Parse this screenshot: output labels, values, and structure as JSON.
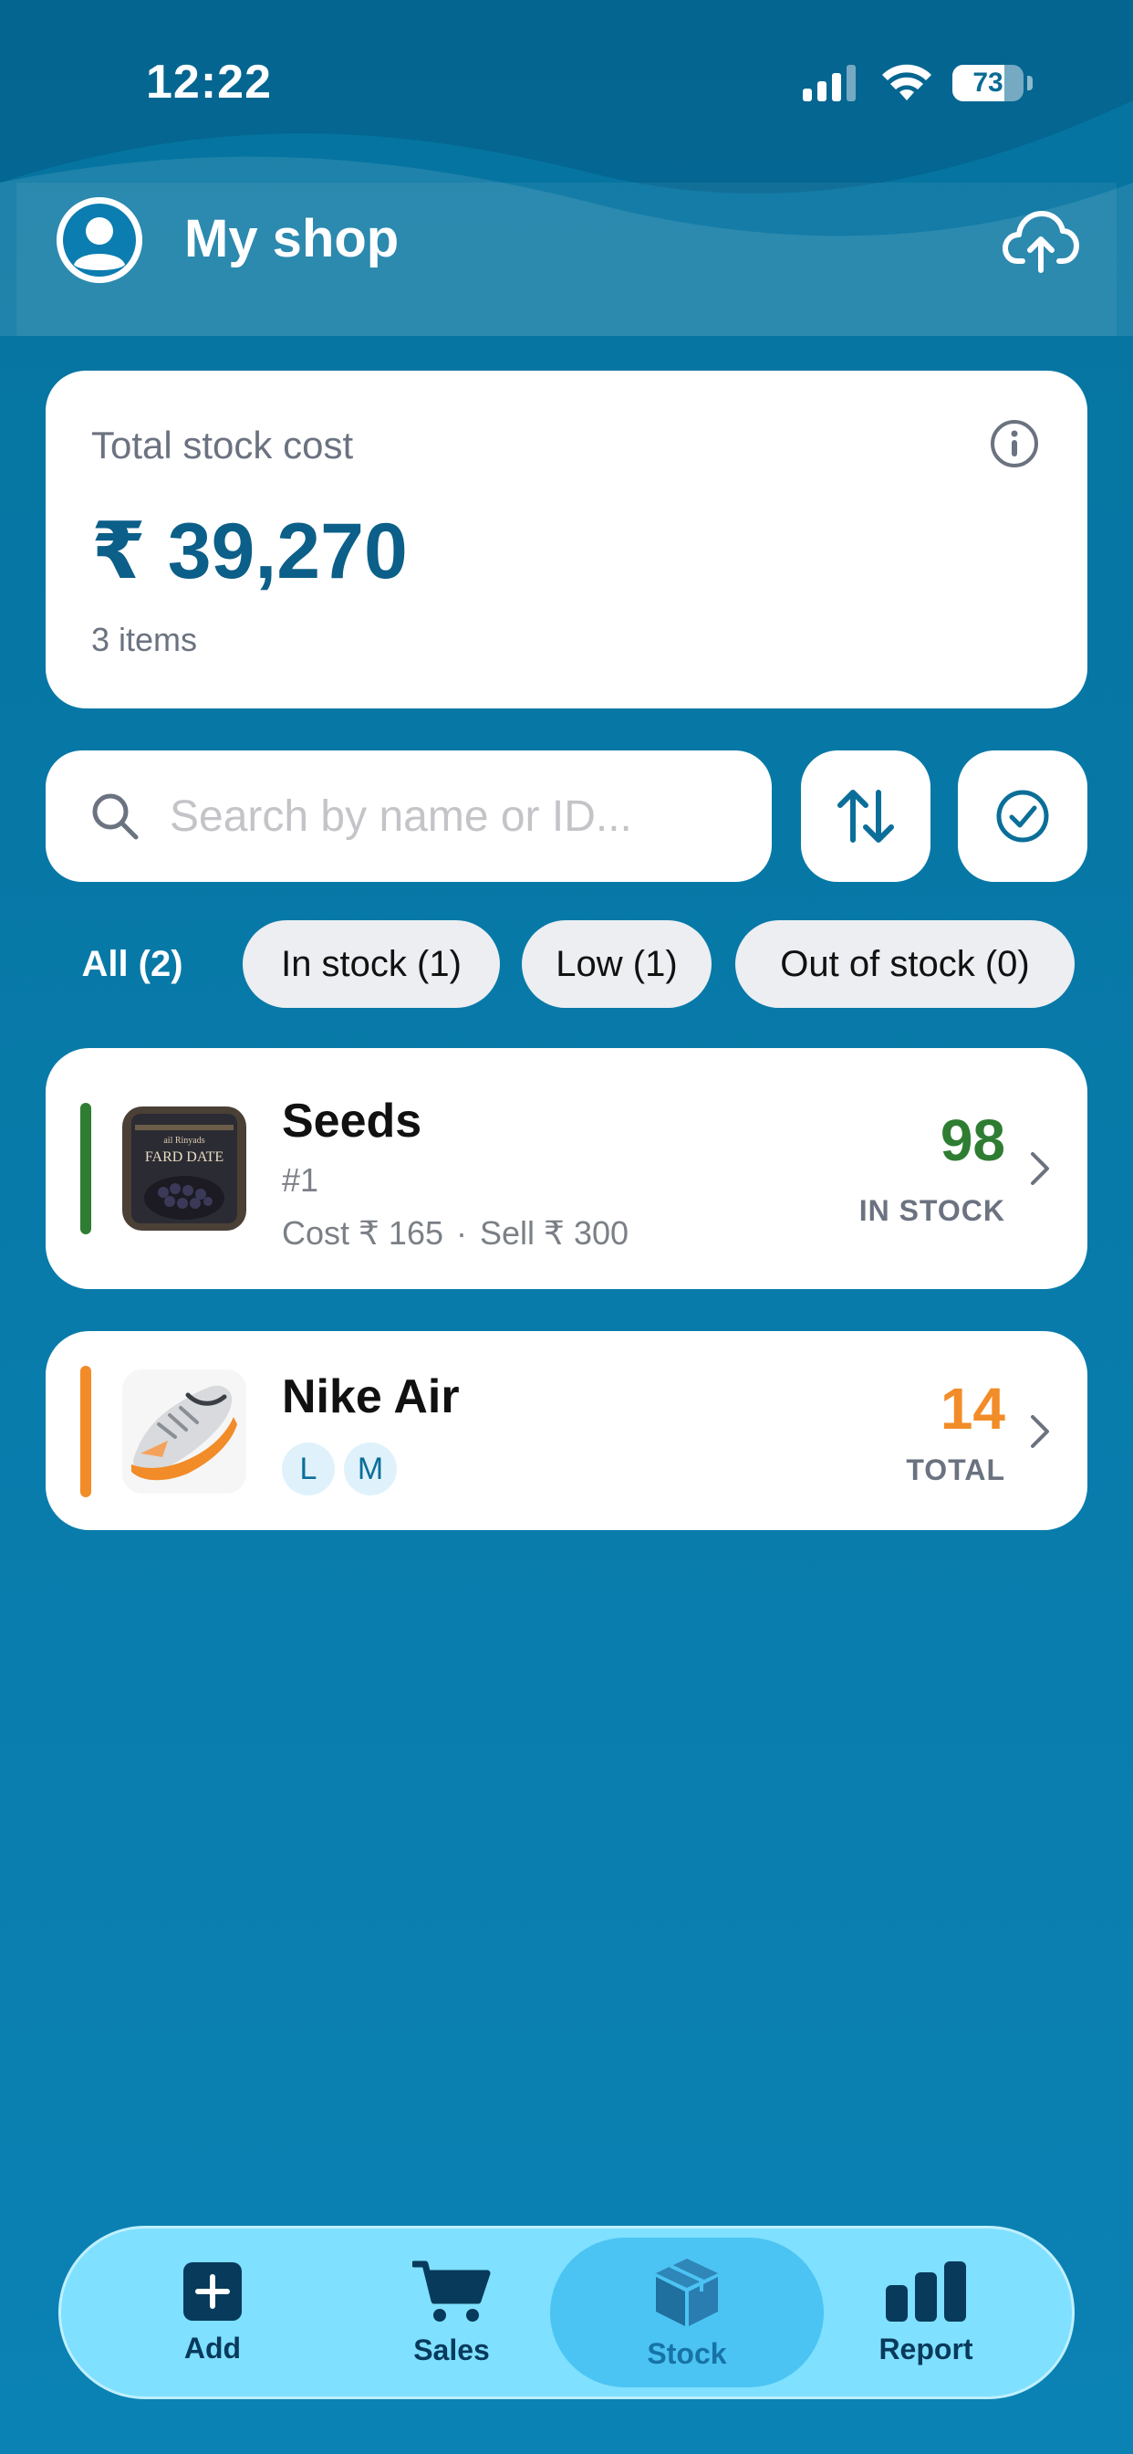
{
  "status_bar": {
    "time": "12:22",
    "battery": "73",
    "battery_level": 0.73
  },
  "header": {
    "title": "My shop",
    "avatar_icon": "user-avatar-icon",
    "cloud_icon": "cloud-upload-icon"
  },
  "summary": {
    "label": "Total stock cost",
    "value": "₹ 39,270",
    "items": "3 items",
    "info_icon": "info-icon"
  },
  "search": {
    "placeholder": "Search by name or ID...",
    "value": ""
  },
  "filters": [
    {
      "label": "All (2)",
      "active": true
    },
    {
      "label": "In stock (1)",
      "active": false
    },
    {
      "label": "Low (1)",
      "active": false
    },
    {
      "label": "Out of stock (0)",
      "active": false
    }
  ],
  "products": [
    {
      "name": "Seeds",
      "id": "#1",
      "cost": "Cost ₹ 165",
      "sell": "Sell ₹ 300",
      "separator": "·",
      "qty": "98",
      "qty_label": "IN STOCK",
      "image_text": "FARD DATE",
      "accent_color": "#2e7d32",
      "qty_color": "#2e7d32"
    },
    {
      "name": "Nike Air",
      "sizes": [
        "L",
        "M"
      ],
      "qty": "14",
      "qty_label": "TOTAL",
      "accent_color": "#f28c28",
      "qty_color": "#f28c28"
    }
  ],
  "nav": [
    {
      "label": "Add",
      "icon": "add-square-icon"
    },
    {
      "label": "Sales",
      "icon": "cart-icon"
    },
    {
      "label": "Stock",
      "icon": "box-icon",
      "active": true
    },
    {
      "label": "Report",
      "icon": "bar-chart-icon"
    }
  ],
  "colors": {
    "background": "#0a7aad",
    "primary": "#0b5f88",
    "nav_bg": "#7fe0ff",
    "nav_active": "#4cc4f3",
    "in_stock": "#2e7d32",
    "low": "#f28c28"
  }
}
